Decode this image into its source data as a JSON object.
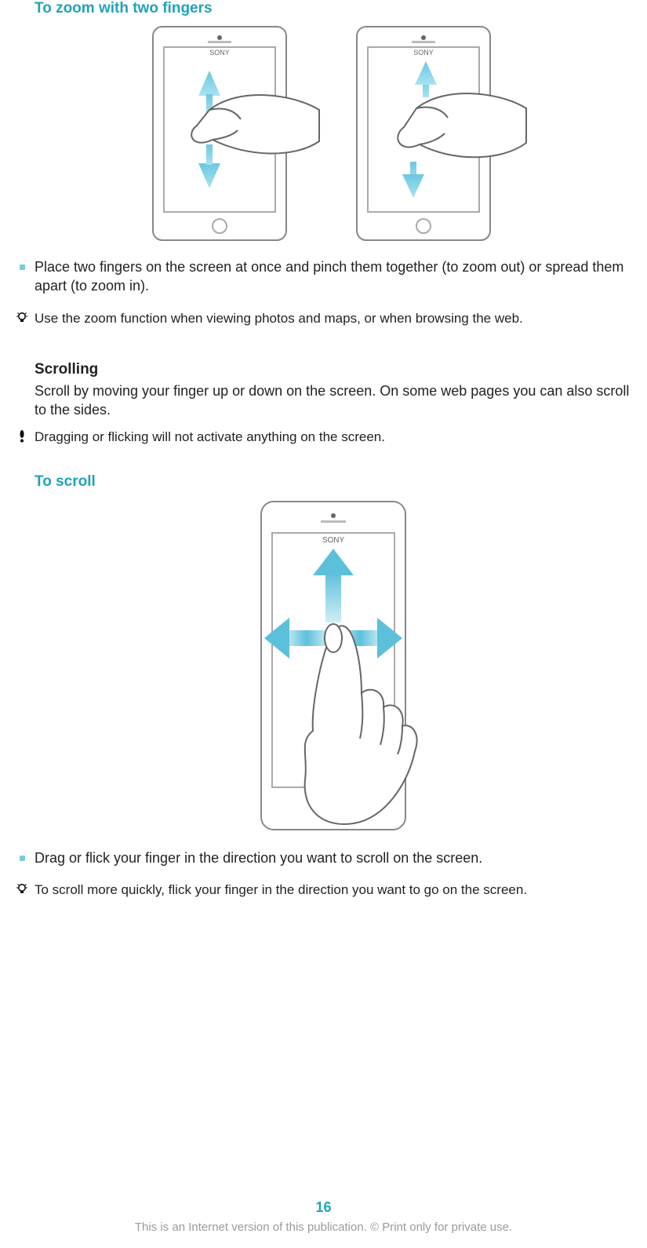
{
  "accent": "#1fa3ba",
  "sections": {
    "zoom": {
      "heading": "To zoom with two fingers",
      "bullet": "Place two fingers on the screen at once and pinch them together (to zoom out) or spread them apart (to zoom in).",
      "tip": "Use the zoom function when viewing photos and maps, or when browsing the web."
    },
    "scrolling": {
      "heading": "Scrolling",
      "intro": "Scroll by moving your finger up or down on the screen. On some web pages you can also scroll to the sides.",
      "note": "Dragging or flicking will not activate anything on the screen."
    },
    "scroll": {
      "heading": "To scroll",
      "bullet": "Drag or flick your finger in the direction you want to scroll on the screen.",
      "tip": "To scroll more quickly, flick your finger in the direction you want to go on the screen."
    }
  },
  "footer": {
    "page": "16",
    "disclaimer": "This is an Internet version of this publication. © Print only for private use."
  }
}
